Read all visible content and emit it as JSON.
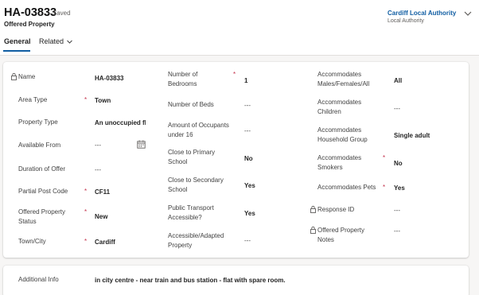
{
  "header": {
    "record_id": "HA-03833",
    "save_status": "- Saved",
    "entity_type": "Offered Property",
    "owner_name": "Cardiff Local Authority",
    "owner_type": "Local Authority"
  },
  "tabs": {
    "general": "General",
    "related": "Related"
  },
  "fields": {
    "name": {
      "label": "Name",
      "value": "HA-03833"
    },
    "area_type": {
      "label": "Area Type",
      "required": "*",
      "value": "Town"
    },
    "property_type": {
      "label": "Property Type",
      "value": "An unoccupied fla"
    },
    "available_from": {
      "label": "Available From",
      "value": "---"
    },
    "duration_of_offer": {
      "label": "Duration of Offer",
      "value": "---"
    },
    "partial_post_code": {
      "label": "Partial Post Code",
      "required": "*",
      "value": "CF11"
    },
    "offered_property_status": {
      "label1": "Offered Property",
      "label2": "Status",
      "required": "*",
      "value": "New"
    },
    "town_city": {
      "label": "Town/City",
      "required": "*",
      "value": "Cardiff"
    },
    "number_of_bedrooms": {
      "label1": "Number of",
      "label2": "Bedrooms",
      "required": "*",
      "value": "1"
    },
    "number_of_beds": {
      "label": "Number of Beds",
      "value": "---"
    },
    "amount_of_occupants": {
      "label1": "Amount of Occupants",
      "label2": "under 16",
      "value": "---"
    },
    "close_to_primary": {
      "label1": "Close to Primary",
      "label2": "School",
      "value": "No"
    },
    "close_to_secondary": {
      "label1": "Close to Secondary",
      "label2": "School",
      "value": "Yes"
    },
    "public_transport": {
      "label1": "Public Transport",
      "label2": "Accessible?",
      "value": "Yes"
    },
    "accessible_property": {
      "label1": "Accessible/Adapted",
      "label2": "Property",
      "value": "---"
    },
    "accommodates_gender": {
      "label1": "Accommodates",
      "label2": "Males/Females/All",
      "value": "All"
    },
    "accommodates_children": {
      "label1": "Accommodates",
      "label2": "Children",
      "value": "---"
    },
    "accommodates_household": {
      "label1": "Accommodates",
      "label2": "Household Group",
      "value": "Single adult"
    },
    "accommodates_smokers": {
      "label1": "Accommodates",
      "label2": "Smokers",
      "required": "*",
      "value": "No"
    },
    "accommodates_pets": {
      "label": "Accommodates Pets",
      "required": "*",
      "value": "Yes"
    },
    "response_id": {
      "label": "Response ID",
      "value": "---"
    },
    "offered_property_notes": {
      "label1": "Offered Property",
      "label2": "Notes",
      "value": "---"
    },
    "additional_info": {
      "label": "Additional Info",
      "value": "in city centre - near train and bus station - flat with spare room."
    }
  },
  "colors": {
    "accent": "#115ea3",
    "required": "#c4314b",
    "background": "#f7f6f5"
  },
  "icons": [
    "chevron-down-icon",
    "lock-icon",
    "calendar-icon"
  ]
}
